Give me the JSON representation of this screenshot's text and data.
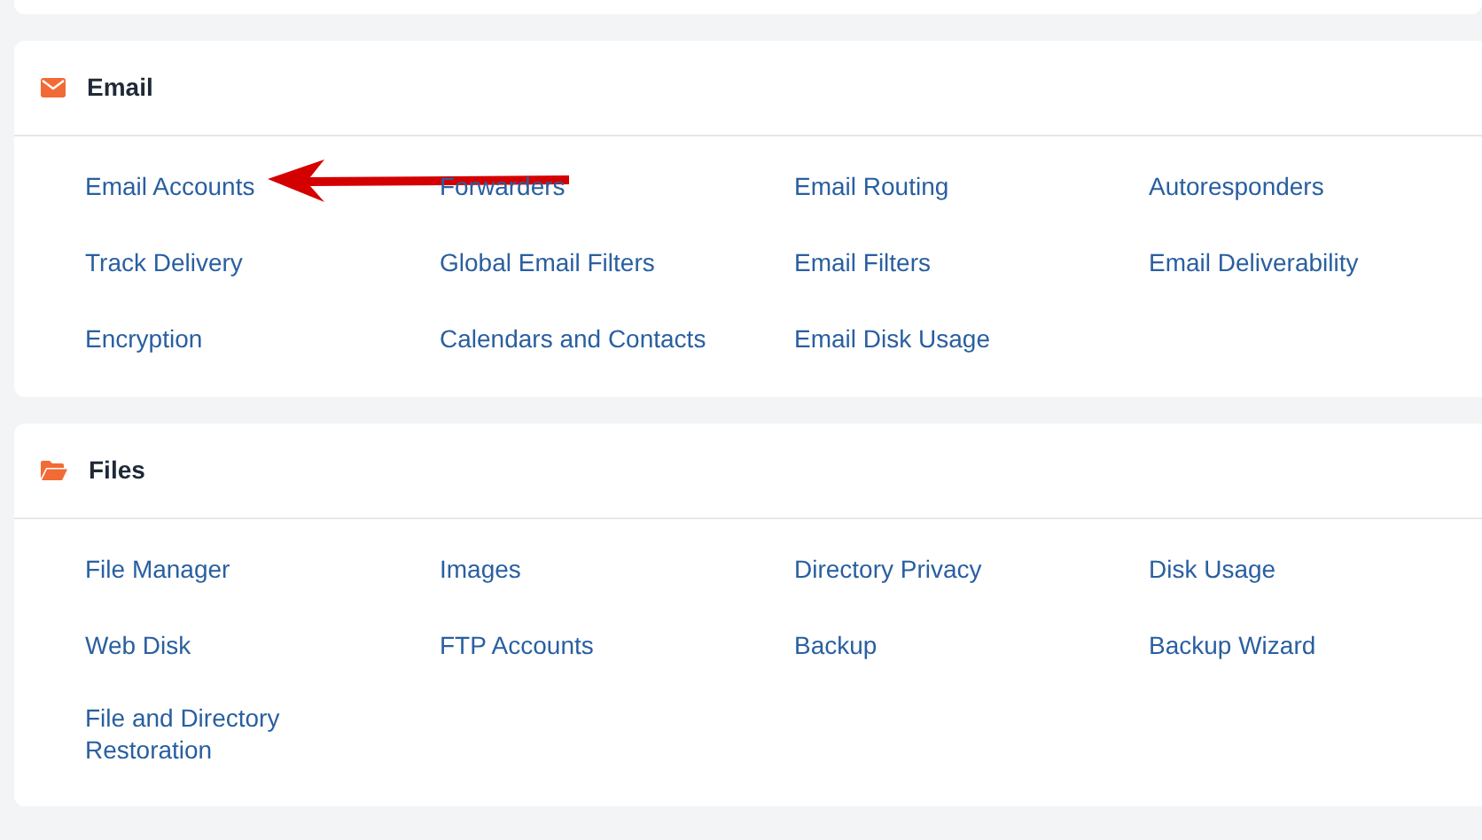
{
  "sections": [
    {
      "title": "Email",
      "items": [
        {
          "label": "Email Accounts",
          "annotated": true
        },
        {
          "label": "Forwarders",
          "annotated": false
        },
        {
          "label": "Email Routing",
          "annotated": false
        },
        {
          "label": "Autoresponders",
          "annotated": false
        },
        {
          "label": "Track Delivery",
          "annotated": false
        },
        {
          "label": "Global Email Filters",
          "annotated": false
        },
        {
          "label": "Email Filters",
          "annotated": false
        },
        {
          "label": "Email Deliverability",
          "annotated": false
        },
        {
          "label": "Encryption",
          "annotated": false
        },
        {
          "label": "Calendars and Contacts",
          "annotated": false
        },
        {
          "label": "Email Disk Usage",
          "annotated": false
        }
      ]
    },
    {
      "title": "Files",
      "items": [
        {
          "label": "File Manager",
          "annotated": false
        },
        {
          "label": "Images",
          "annotated": false
        },
        {
          "label": "Directory Privacy",
          "annotated": false
        },
        {
          "label": "Disk Usage",
          "annotated": false
        },
        {
          "label": "Web Disk",
          "annotated": false
        },
        {
          "label": "FTP Accounts",
          "annotated": false
        },
        {
          "label": "Backup",
          "annotated": false
        },
        {
          "label": "Backup Wizard",
          "annotated": false
        },
        {
          "label": "File and Directory Restoration",
          "annotated": false
        }
      ]
    }
  ]
}
